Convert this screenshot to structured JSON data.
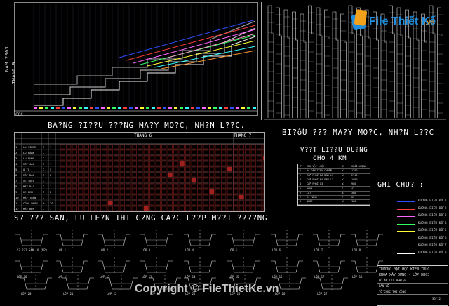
{
  "top_left": {
    "year_label": "NĂM 2003",
    "month_label": "THÁNG 9",
    "corner_label": "CỌC"
  },
  "titles": {
    "main_chart": "BA?NG ?I??U ???NG MA?Y MO?C, NH?N L??C.",
    "right_chart": "BI?ồU ??? MA?Y MO?C, NH?N L??C",
    "schedule": "S? ??? SAN, LU LE?N THI C?NG CA?C L??P M??T ????NG",
    "vehicles": "V??T LI??U DU?NG",
    "vehicles_sub": "CHO 4 KM",
    "note": "GHI CHU? :"
  },
  "schedule_table": {
    "header_months": [
      "THÁNG 6",
      "THÁNG 7"
    ],
    "left_headers": [
      "STT",
      "MÁY MÓC",
      "ĐV",
      "SỐ LƯỢNG"
    ],
    "rows": [
      [
        "1",
        "LU VIBTR",
        "C",
        "1"
      ],
      [
        "2",
        "LU BÁNH",
        "C",
        "1"
      ],
      [
        "3",
        "LU RUNG",
        "C",
        "1"
      ],
      [
        "4",
        "MÁY SAN",
        "C",
        "1"
      ],
      [
        "5",
        "Ô TÔ",
        "C",
        "5"
      ],
      [
        "6",
        "MÁY ĐÀO",
        "C",
        "2"
      ],
      [
        "7",
        "XE TƯỚI",
        "C",
        "1"
      ],
      [
        "8",
        "MÁY RẢI",
        "C",
        "1"
      ],
      [
        "9",
        "XE BEN",
        "C",
        "2"
      ],
      [
        "10",
        "MÁY TRỘN",
        "C",
        "1"
      ],
      [
        "11",
        "CÔNG NHÂN",
        "N",
        "20"
      ],
      [
        "12",
        "MÁY BƠM",
        "C",
        "1"
      ]
    ]
  },
  "vehicle_table": {
    "headers": [
      "TT",
      "TÊN VẬT LIỆU",
      "ĐV",
      "KHỐI LƯỢNG"
    ],
    "rows": [
      [
        "1",
        "ĐÁ DĂM TIÊU CHUẨN",
        "m3",
        "1250"
      ],
      [
        "2",
        "CẤP PHỐI ĐÁ DĂM L1",
        "m3",
        "2140"
      ],
      [
        "3",
        "CẤP PHỐI ĐÁ DĂM L2",
        "m3",
        "1860"
      ],
      [
        "4",
        "CẤP PHỐI L3",
        "m3",
        "980"
      ],
      [
        "5",
        "NHỰA",
        "T",
        "42"
      ],
      [
        "6",
        "CÁT",
        "m3",
        "360"
      ],
      [
        "7",
        "XI MĂNG",
        "T",
        "85"
      ],
      [
        "8",
        "NƯỚC",
        "m3",
        "120"
      ]
    ]
  },
  "legend": {
    "items": [
      {
        "label": "ĐƯỜNG BIỂU ĐỒ 1",
        "color": "#2f4fff"
      },
      {
        "label": "ĐƯỜNG BIỂU ĐỒ 2",
        "color": "#ff3b3b"
      },
      {
        "label": "ĐƯỜNG BIỂU ĐỒ 3",
        "color": "#ff66ff"
      },
      {
        "label": "ĐƯỜNG BIỂU ĐỒ 4",
        "color": "#33ff66"
      },
      {
        "label": "ĐƯỜNG BIỂU ĐỒ 5",
        "color": "#ffff33"
      },
      {
        "label": "ĐƯỜNG BIỂU ĐỒ 6",
        "color": "#33ffff"
      },
      {
        "label": "ĐƯỜNG BIỂU ĐỒ 7",
        "color": "#ff9933"
      },
      {
        "label": "ĐƯỜNG BIỂU ĐỒ 8",
        "color": "#ffffff"
      }
    ]
  },
  "section_labels": {
    "row1": [
      "S? ??? SAN LU (M?)",
      "LỚP 1",
      "LỚP 2",
      "LỚP 3",
      "LỚP 4",
      "LỚP 5",
      "LỚP 6",
      "LỚP 7",
      "LỚP 8",
      "LỚP 9"
    ],
    "row2": [
      "LỚP 10",
      "LỚP 11",
      "LỚP 12",
      "LỚP 13",
      "LỚP 14",
      "LỚP 15",
      "LỚP 16",
      "LỚP 17",
      "LỚP 18",
      "LỚP 19"
    ],
    "row3": [
      "LỚP 20",
      "LỚP 21",
      "LỚP 22",
      "LỚP 23",
      "LỚP 24",
      "LỚP 25",
      "LỚP 26",
      "LỚP 27"
    ]
  },
  "title_block": {
    "school": "TRƯỜNG ĐẠI HỌC KIẾN TRÚC",
    "dept": "KHOA XÂY DỰNG - LỚP ĐH03",
    "project": "ĐỒ ÁN TỐT NGHIỆP",
    "sheet": "BẢN VẼ",
    "sheet_no": "TỔ CHỨC THI CÔNG",
    "num": "Số 12"
  },
  "watermark": {
    "logo_text": "File Thiết Kế",
    "logo_suffix": ".vn",
    "copyright": "Copyright © FileThietKe.vn"
  }
}
